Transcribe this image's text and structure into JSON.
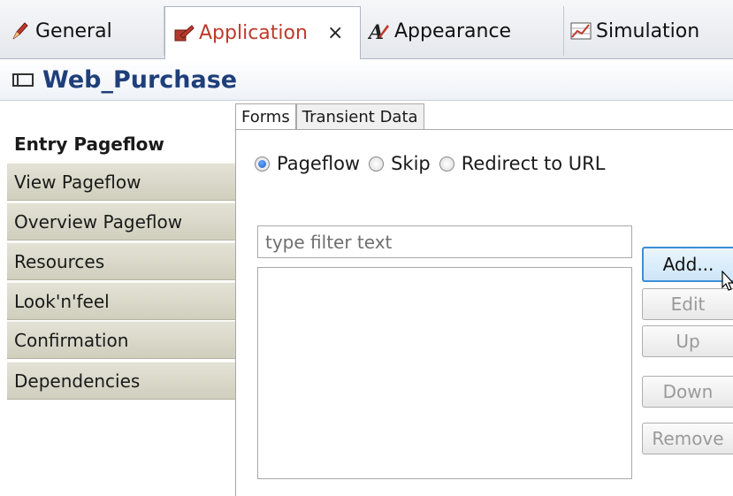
{
  "tabs": [
    {
      "label": "General",
      "icon": "pen-icon"
    },
    {
      "label": "Application",
      "icon": "application-icon",
      "active": true,
      "close": "×"
    },
    {
      "label": "Appearance",
      "icon": "appearance-icon"
    },
    {
      "label": "Simulation",
      "icon": "simulation-icon"
    }
  ],
  "header": {
    "title": "Web_Purchase"
  },
  "sidebar": {
    "items": [
      {
        "label": "Entry Pageflow",
        "active": true
      },
      {
        "label": "View Pageflow"
      },
      {
        "label": "Overview Pageflow"
      },
      {
        "label": "Resources"
      },
      {
        "label": "Look'n'feel"
      },
      {
        "label": "Confirmation"
      },
      {
        "label": "Dependencies"
      }
    ]
  },
  "inner_tabs": [
    {
      "label": "Forms",
      "active": true
    },
    {
      "label": "Transient Data"
    }
  ],
  "radios": [
    {
      "label": "Pageflow",
      "selected": true
    },
    {
      "label": "Skip",
      "selected": false
    },
    {
      "label": "Redirect to URL",
      "selected": false
    }
  ],
  "filter": {
    "placeholder": "type filter text",
    "value": ""
  },
  "buttons": {
    "add": "Add...",
    "edit": "Edit",
    "up": "Up",
    "down": "Down",
    "remove": "Remove"
  },
  "colors": {
    "active_tab_text": "#c0392b",
    "title_text": "#1f3f7a",
    "nav_bg": "#d9d8c8",
    "focus_border": "#3c8fd6"
  }
}
